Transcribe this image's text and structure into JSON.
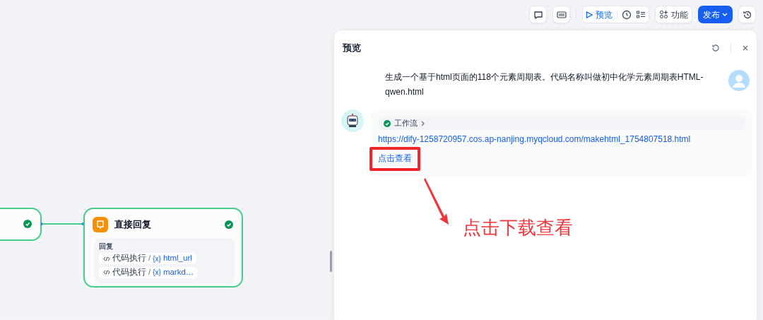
{
  "toolbar": {
    "preview_label": "预览",
    "features_label": "功能",
    "publish_label": "发布"
  },
  "canvas": {
    "nodes": [
      {
        "kind": "partial",
        "succeeded": true
      },
      {
        "kind": "answer",
        "title": "直接回复",
        "succeeded": true,
        "section_label": "回复",
        "variables": [
          {
            "source": "代码执行",
            "separator": "/",
            "marker": "{x}",
            "name": "html_url"
          },
          {
            "source": "代码执行",
            "separator": "/",
            "marker": "{x}",
            "name": "markd…"
          }
        ]
      }
    ]
  },
  "preview": {
    "title": "预览",
    "messages": [
      {
        "kind": "user",
        "text": "生成一个基于html页面的118个元素周期表。代码名称叫做初中化学元素周期表HTML-qwen.html"
      },
      {
        "kind": "bot",
        "workflow": {
          "label": "工作流",
          "succeeded": true
        },
        "link": "https://dify-1258720957.cos.ap-nanjing.myqcloud.com/makehtml_1754807518.html",
        "action": "点击查看"
      }
    ]
  },
  "annotation": {
    "text": "点击下载查看"
  }
}
